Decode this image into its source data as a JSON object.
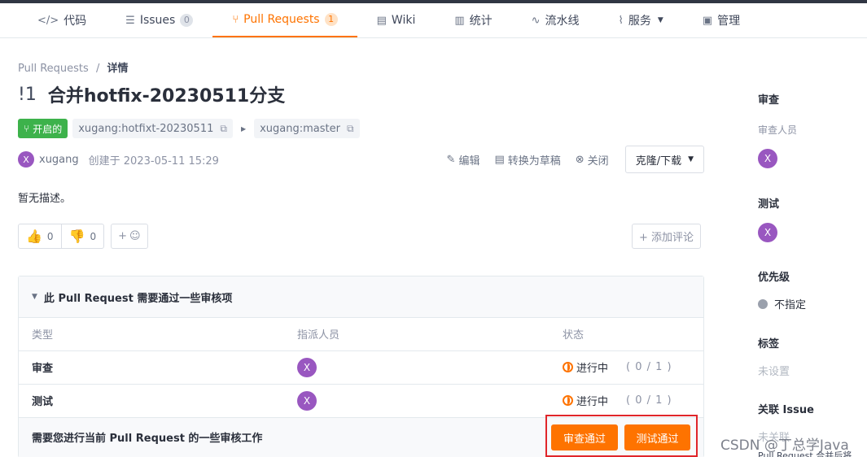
{
  "tabs": [
    {
      "label": "代码",
      "icon": "code-icon",
      "glyph": "</>"
    },
    {
      "label": "Issues",
      "icon": "issues-icon",
      "glyph": "☰",
      "count": "0"
    },
    {
      "label": "Pull Requests",
      "icon": "pull-request-icon",
      "glyph": "⑂",
      "count": "1",
      "active": true
    },
    {
      "label": "Wiki",
      "icon": "wiki-icon",
      "glyph": "▤"
    },
    {
      "label": "统计",
      "icon": "chart-icon",
      "glyph": "▥"
    },
    {
      "label": "流水线",
      "icon": "pipeline-icon",
      "glyph": "∿"
    },
    {
      "label": "服务",
      "icon": "service-icon",
      "glyph": "⌇"
    },
    {
      "label": "管理",
      "icon": "manage-icon",
      "glyph": "▣"
    }
  ],
  "breadcrumb": {
    "root": "Pull Requests",
    "sep": "/",
    "current": "详情"
  },
  "pr": {
    "number": "!1",
    "title": "合并hotfix-20230511分支",
    "state": "开启的",
    "source_branch": "xugang:hotfixt-20230511",
    "target_branch": "xugang:master",
    "author_initial": "X",
    "author": "xugang",
    "created": "创建于 2023-05-11 15:29",
    "description": "暂无描述。"
  },
  "actions": {
    "edit": "编辑",
    "draft": "转换为草稿",
    "close": "关闭",
    "clone": "克隆/下载"
  },
  "reactions": {
    "up_count": "0",
    "down_count": "0",
    "add_emoji": "+",
    "add_comment": "+ 添加评论"
  },
  "review": {
    "header": "此 Pull Request 需要通过一些审核项",
    "columns": [
      "类型",
      "指派人员",
      "状态"
    ],
    "rows": [
      {
        "type": "审查",
        "assignee_initial": "X",
        "status": "进行中",
        "progress": "( 0 / 1 )"
      },
      {
        "type": "测试",
        "assignee_initial": "X",
        "status": "进行中",
        "progress": "( 0 / 1 )"
      }
    ],
    "footer": "需要您进行当前 Pull Request 的一些审核工作",
    "approve_review": "审查通过",
    "approve_test": "测试通过"
  },
  "sidebar": {
    "review_title": "审查",
    "reviewers_label": "审查人员",
    "reviewer_initial": "X",
    "test_title": "测试",
    "tester_initial": "X",
    "priority_title": "优先级",
    "priority_value": "不指定",
    "labels_title": "标签",
    "labels_value": "未设置",
    "issue_title": "关联 Issue",
    "issue_value": "未关联",
    "issue_note": "Pull Request 合并后将"
  },
  "watermark": "CSDN @丁总学Java",
  "colors": {
    "accent": "#fe7300",
    "open_green": "#3db24b",
    "avatar": "#9957c0",
    "highlight_border": "#e0252a"
  }
}
